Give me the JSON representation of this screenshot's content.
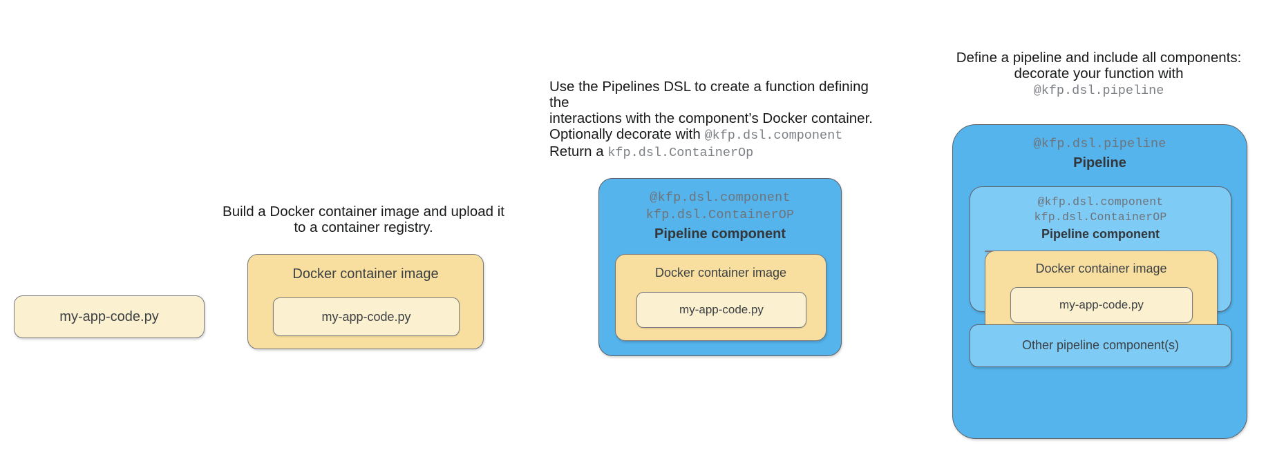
{
  "diagram": {
    "title": "Kubeflow Pipelines component build-up diagram",
    "background": "#ffffff",
    "palette": {
      "cream": "#fbf0d0",
      "gold": "#f8dfa0",
      "blue_dark": "#55b4ec",
      "blue_light": "#7ecbf6",
      "stroke": "#60636a",
      "text": "#3c4043",
      "mono_text": "#6f7379"
    }
  },
  "stages": [
    {
      "id": "source-code",
      "caption": null,
      "boxes": {
        "code": "my-app-code.py"
      }
    },
    {
      "id": "docker-image",
      "caption": {
        "line1": "Build a Docker container image and upload it",
        "line2": "to a container registry."
      },
      "boxes": {
        "image_title": "Docker container image",
        "code": "my-app-code.py"
      }
    },
    {
      "id": "pipeline-component",
      "caption": {
        "line1": "Use the Pipelines DSL to create a function defining the",
        "line2": "interactions with the component’s Docker container.",
        "line3_prefix": "Optionally decorate with ",
        "line3_mono": "@kfp.dsl.component",
        "line4_prefix": "Return a ",
        "line4_mono": "kfp.dsl.ContainerOp"
      },
      "boxes": {
        "component_decorator": "@kfp.dsl.component",
        "component_type": "kfp.dsl.ContainerOP",
        "component_title": "Pipeline component",
        "image_title": "Docker container image",
        "code": "my-app-code.py"
      }
    },
    {
      "id": "pipeline",
      "caption": {
        "line1": "Define a pipeline and include all components:",
        "line2": "decorate your function with",
        "line3_mono": "@kfp.dsl.pipeline"
      },
      "boxes": {
        "pipeline_decorator": "@kfp.dsl.pipeline",
        "pipeline_title": "Pipeline",
        "component_decorator": "@kfp.dsl.component",
        "component_type": "kfp.dsl.ContainerOP",
        "component_title": "Pipeline component",
        "image_title": "Docker container image",
        "code": "my-app-code.py",
        "other_components": "Other pipeline component(s)"
      }
    }
  ]
}
